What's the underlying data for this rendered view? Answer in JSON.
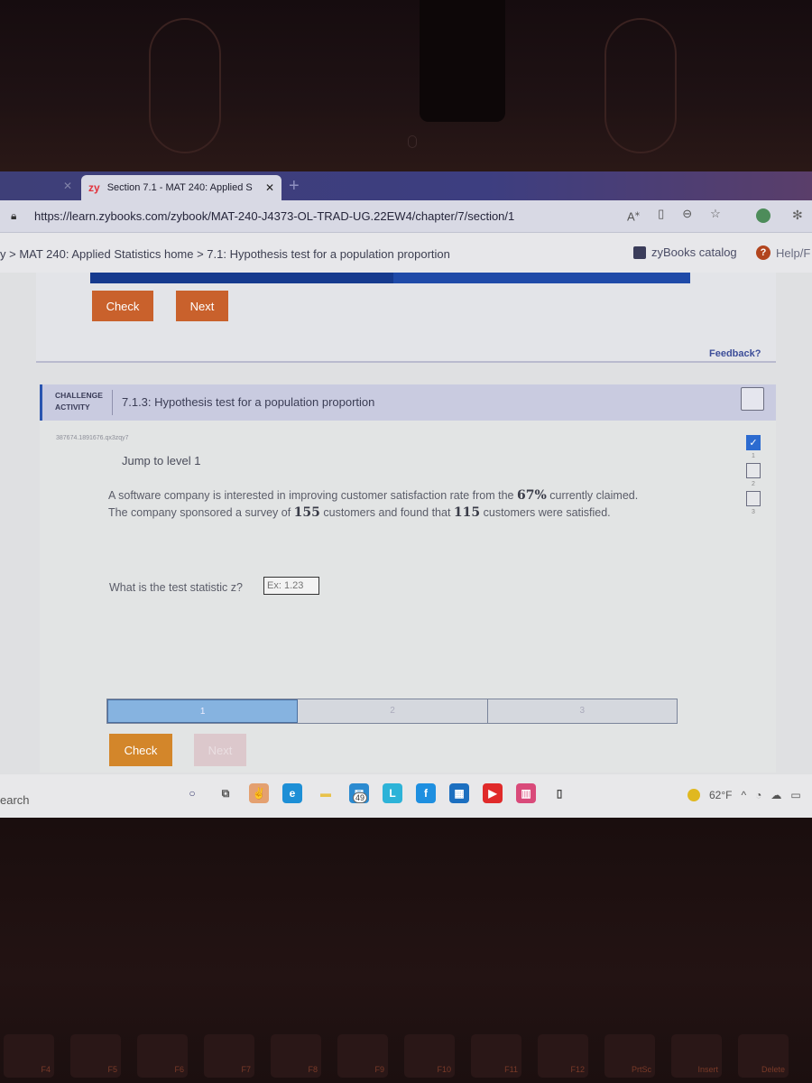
{
  "browser": {
    "tab": {
      "brand": "zy",
      "title": "Section 7.1 - MAT 240: Applied S",
      "close_glyph": "✕"
    },
    "prev_tab_close_glyph": "✕",
    "new_tab_glyph": "+",
    "url": "https://learn.zybooks.com/zybook/MAT-240-J4373-OL-TRAD-UG.22EW4/chapter/7/section/1",
    "address_icons": [
      "read-aloud-icon",
      "immersive-reader-icon",
      "zoom-out-icon",
      "favorites-icon"
    ]
  },
  "zybooks": {
    "breadcrumb": "y > MAT 240: Applied Statistics home > 7.1: Hypothesis test for a population proportion",
    "catalog_label": "zyBooks catalog",
    "help_label": "Help/F"
  },
  "previous_activity": {
    "check_label": "Check",
    "next_label": "Next",
    "feedback_label": "Feedback?"
  },
  "challenge": {
    "type_line1": "CHALLENGE",
    "type_line2": "ACTIVITY",
    "title": "7.1.3: Hypothesis test for a population proportion",
    "code_id": "387674.1891676.qx3zqy7",
    "jump_label": "Jump to level 1",
    "problem_parts": {
      "p1": "A software company is interested in improving customer satisfaction rate from the ",
      "claimed_rate": "67%",
      "p2": " currently claimed.",
      "p3": "The company sponsored a survey of ",
      "sample_size": "155",
      "p4": " customers and found that ",
      "satisfied": "115",
      "p5": " customers were satisfied."
    },
    "question": "What is the test statistic z?",
    "answer_placeholder": "Ex: 1.23",
    "answer_value": "",
    "levels": [
      {
        "num": "1",
        "completed": true
      },
      {
        "num": "2",
        "completed": false
      },
      {
        "num": "3",
        "completed": false
      }
    ],
    "progress_segments": [
      {
        "label": "1",
        "active": true
      },
      {
        "label": "2",
        "active": false
      },
      {
        "label": "3",
        "active": false
      }
    ],
    "check_label": "Check",
    "next_label": "Next",
    "next_disabled": true
  },
  "taskbar": {
    "search_text": "earch",
    "apps": [
      {
        "name": "cortana-icon",
        "glyph": "○",
        "bg": "transparent",
        "fg": "#3a3c70"
      },
      {
        "name": "task-view-icon",
        "glyph": "⧉",
        "bg": "transparent",
        "fg": "#555"
      },
      {
        "name": "app-orange-icon",
        "glyph": "✌",
        "bg": "#e4a070",
        "fg": "#6a2a10"
      },
      {
        "name": "edge-icon",
        "glyph": "e",
        "bg": "#1d8fd6",
        "fg": "#fff"
      },
      {
        "name": "file-explorer-icon",
        "glyph": "▬",
        "bg": "transparent",
        "fg": "#e8c24a"
      },
      {
        "name": "mail-icon",
        "glyph": "✉",
        "bg": "#2b8ad0",
        "fg": "#fff"
      },
      {
        "name": "app-l-icon",
        "glyph": "L",
        "bg": "#2db3d8",
        "fg": "#fff"
      },
      {
        "name": "facebook-icon",
        "glyph": "f",
        "bg": "#1e8fe0",
        "fg": "#fff"
      },
      {
        "name": "store-icon",
        "glyph": "▦",
        "bg": "#1c6fc0",
        "fg": "#fff"
      },
      {
        "name": "youtube-icon",
        "glyph": "▶",
        "bg": "#e02a2a",
        "fg": "#fff"
      },
      {
        "name": "news-icon",
        "glyph": "▥",
        "bg": "#d94a7a",
        "fg": "#fff"
      },
      {
        "name": "notepad-icon",
        "glyph": "▯",
        "bg": "transparent",
        "fg": "#444"
      }
    ],
    "mail_badge": "49",
    "temperature": "62°F",
    "tray_chevron": "^",
    "colors": {
      "accent": "#c9612c",
      "check_orange": "#d3862a",
      "brand_blue": "#1f4aa8"
    }
  }
}
